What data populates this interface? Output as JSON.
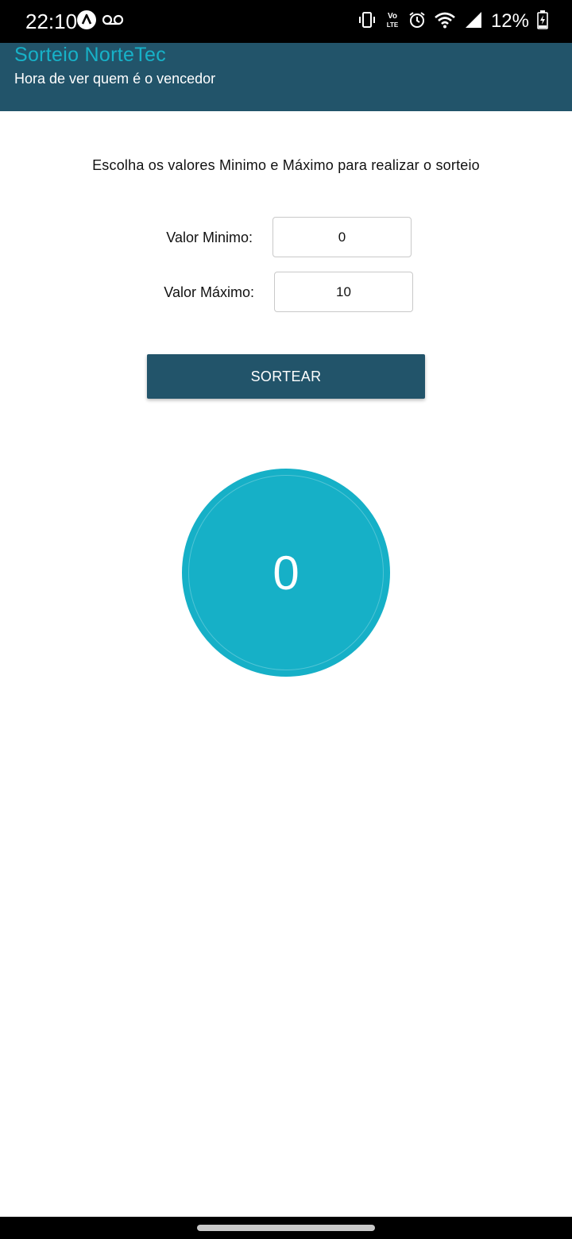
{
  "status_bar": {
    "time": "22:10",
    "battery_percent": "12%",
    "icons": [
      "app-notification-icon",
      "voicemail-icon",
      "vibrate-icon",
      "volte-icon",
      "alarm-icon",
      "wifi-icon",
      "signal-icon",
      "battery-charging-icon"
    ],
    "volte_label_top": "Vo",
    "volte_label_bottom": "LTE"
  },
  "header": {
    "title": "Sorteio NorteTec",
    "subtitle": "Hora de ver quem é o vencedor",
    "title_color": "#17b2c8",
    "background_color": "#22546a"
  },
  "main": {
    "instruction": "Escolha os valores Minimo e Máximo para realizar o sorteio",
    "min_label": "Valor Minimo:",
    "min_value": "0",
    "max_label": "Valor Máximo:",
    "max_value": "10",
    "draw_button_label": "SORTEAR",
    "result_value": "0",
    "result_color": "#16b0c7"
  }
}
